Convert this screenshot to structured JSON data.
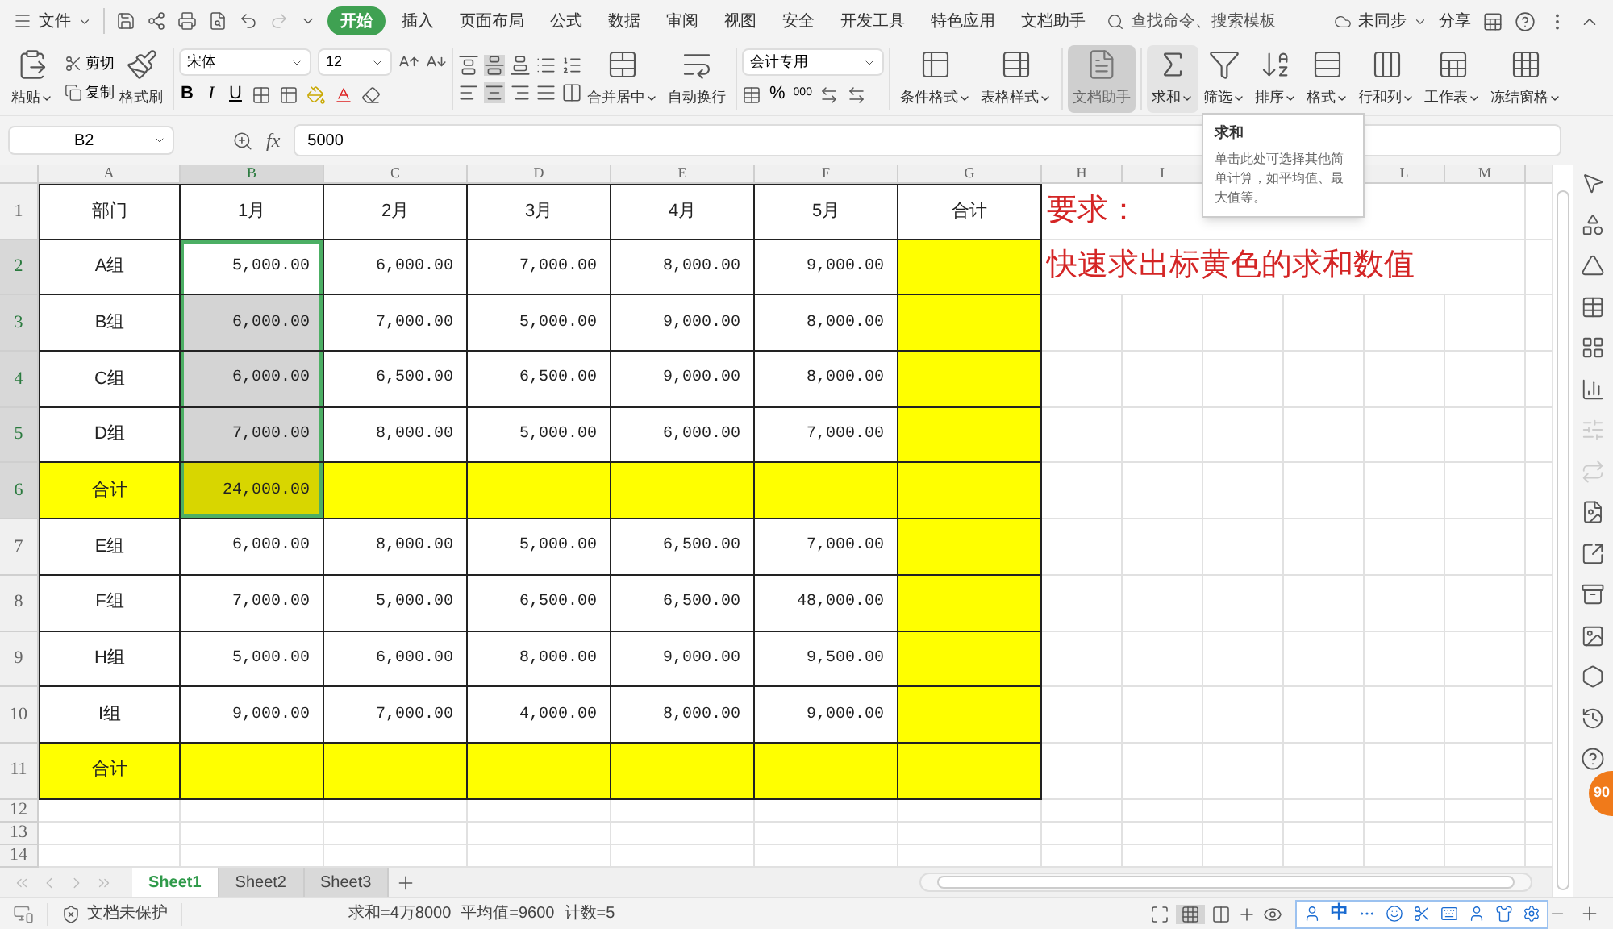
{
  "top_bar": {
    "file_menu": "文件",
    "tabs": [
      {
        "label": "开始",
        "selected": true
      },
      {
        "label": "插入",
        "selected": false
      },
      {
        "label": "页面布局",
        "selected": false
      },
      {
        "label": "公式",
        "selected": false
      },
      {
        "label": "数据",
        "selected": false
      },
      {
        "label": "审阅",
        "selected": false
      },
      {
        "label": "视图",
        "selected": false
      },
      {
        "label": "安全",
        "selected": false
      },
      {
        "label": "开发工具",
        "selected": false
      },
      {
        "label": "特色应用",
        "selected": false
      },
      {
        "label": "文档助手",
        "selected": false
      }
    ],
    "search": "查找命令、搜索模板",
    "sync": "未同步",
    "share": "分享"
  },
  "ribbon": {
    "paste": "粘贴",
    "cut": "剪切",
    "copy": "复制",
    "format_painter": "格式刷",
    "font_name": "宋体",
    "font_size": "12",
    "style_buttons": [
      "B",
      "I",
      "U"
    ],
    "merge": "合并居中",
    "wrap": "自动换行",
    "number_format": "会计专用",
    "percent": "%",
    "thousands": "000",
    "conditional_format": "条件格式",
    "table_style": "表格样式",
    "doc_assistant": {
      "label": "文档助手",
      "active": true
    },
    "tools": [
      {
        "label": "求和",
        "hovered": true
      },
      {
        "label": "筛选",
        "hovered": false
      },
      {
        "label": "排序",
        "hovered": false
      },
      {
        "label": "格式",
        "hovered": false
      },
      {
        "label": "行和列",
        "hovered": false
      },
      {
        "label": "工作表",
        "hovered": false
      },
      {
        "label": "冻结窗格",
        "hovered": false
      }
    ]
  },
  "formula_bar": {
    "cell_ref": "B2",
    "fx": "fx",
    "value": "5000"
  },
  "tooltip": {
    "title": "求和",
    "body": "单击此处可选择其他简单计算，如平均值、最大值等。"
  },
  "columns": [
    {
      "label": "A",
      "selected": false
    },
    {
      "label": "B",
      "selected": true
    },
    {
      "label": "C",
      "selected": false
    },
    {
      "label": "D",
      "selected": false
    },
    {
      "label": "E",
      "selected": false
    },
    {
      "label": "F",
      "selected": false
    },
    {
      "label": "G",
      "selected": false
    },
    {
      "label": "H",
      "selected": false
    },
    {
      "label": "I",
      "selected": false
    },
    {},
    {},
    {
      "label": "L",
      "selected": false
    },
    {
      "label": "M",
      "selected": false
    }
  ],
  "rows": [
    {
      "header": "1",
      "selected": false,
      "kind": "header",
      "note": "要求：",
      "cells": [
        {
          "text": "部门",
          "highlighted": false,
          "selected": false
        },
        {
          "text": "1月",
          "highlighted": false,
          "selected": false
        },
        {
          "text": "2月",
          "highlighted": false,
          "selected": false
        },
        {
          "text": "3月",
          "highlighted": false,
          "selected": false
        },
        {
          "text": "4月",
          "highlighted": false,
          "selected": false
        },
        {
          "text": "5月",
          "highlighted": false,
          "selected": false
        },
        {
          "text": "合计",
          "highlighted": false,
          "selected": false
        }
      ]
    },
    {
      "header": "2",
      "selected": true,
      "kind": "data",
      "note": "快速求出标黄色的求和数值",
      "cells": [
        {
          "text": "A组",
          "highlighted": false,
          "selected": false
        },
        {
          "text": "5,000.00",
          "highlighted": false,
          "selected": true,
          "active": true
        },
        {
          "text": "6,000.00",
          "highlighted": false,
          "selected": false
        },
        {
          "text": "7,000.00",
          "highlighted": false,
          "selected": false
        },
        {
          "text": "8,000.00",
          "highlighted": false,
          "selected": false
        },
        {
          "text": "9,000.00",
          "highlighted": false,
          "selected": false
        },
        {
          "highlighted": true,
          "selected": false
        }
      ]
    },
    {
      "header": "3",
      "selected": true,
      "kind": "data",
      "cells": [
        {
          "text": "B组",
          "highlighted": false,
          "selected": false
        },
        {
          "text": "6,000.00",
          "highlighted": false,
          "selected": true,
          "active": false
        },
        {
          "text": "7,000.00",
          "highlighted": false,
          "selected": false
        },
        {
          "text": "5,000.00",
          "highlighted": false,
          "selected": false
        },
        {
          "text": "9,000.00",
          "highlighted": false,
          "selected": false
        },
        {
          "text": "8,000.00",
          "highlighted": false,
          "selected": false
        },
        {
          "highlighted": true,
          "selected": false
        }
      ]
    },
    {
      "header": "4",
      "selected": true,
      "kind": "data",
      "cells": [
        {
          "text": "C组",
          "highlighted": false,
          "selected": false
        },
        {
          "text": "6,000.00",
          "highlighted": false,
          "selected": true,
          "active": false
        },
        {
          "text": "6,500.00",
          "highlighted": false,
          "selected": false
        },
        {
          "text": "6,500.00",
          "highlighted": false,
          "selected": false
        },
        {
          "text": "9,000.00",
          "highlighted": false,
          "selected": false
        },
        {
          "text": "8,000.00",
          "highlighted": false,
          "selected": false
        },
        {
          "highlighted": true,
          "selected": false
        }
      ]
    },
    {
      "header": "5",
      "selected": true,
      "kind": "data",
      "cells": [
        {
          "text": "D组",
          "highlighted": false,
          "selected": false
        },
        {
          "text": "7,000.00",
          "highlighted": false,
          "selected": true,
          "active": false
        },
        {
          "text": "8,000.00",
          "highlighted": false,
          "selected": false
        },
        {
          "text": "5,000.00",
          "highlighted": false,
          "selected": false
        },
        {
          "text": "6,000.00",
          "highlighted": false,
          "selected": false
        },
        {
          "text": "7,000.00",
          "highlighted": false,
          "selected": false
        },
        {
          "highlighted": true,
          "selected": false
        }
      ]
    },
    {
      "header": "6",
      "selected": true,
      "kind": "total",
      "cells": [
        {
          "text": "合计",
          "highlighted": true,
          "selected": false
        },
        {
          "text": "24,000.00",
          "highlighted": true,
          "selected": true,
          "active": false
        },
        {
          "highlighted": true,
          "selected": false
        },
        {
          "highlighted": true,
          "selected": false
        },
        {
          "highlighted": true,
          "selected": false
        },
        {
          "highlighted": true,
          "selected": false
        },
        {
          "highlighted": true,
          "selected": false
        }
      ]
    },
    {
      "header": "7",
      "selected": false,
      "kind": "data",
      "cells": [
        {
          "text": "E组",
          "highlighted": false,
          "selected": false
        },
        {
          "text": "6,000.00",
          "highlighted": false,
          "selected": false
        },
        {
          "text": "8,000.00",
          "highlighted": false,
          "selected": false
        },
        {
          "text": "5,000.00",
          "highlighted": false,
          "selected": false
        },
        {
          "text": "6,500.00",
          "highlighted": false,
          "selected": false
        },
        {
          "text": "7,000.00",
          "highlighted": false,
          "selected": false
        },
        {
          "highlighted": true,
          "selected": false
        }
      ]
    },
    {
      "header": "8",
      "selected": false,
      "kind": "data",
      "cells": [
        {
          "text": "F组",
          "highlighted": false,
          "selected": false
        },
        {
          "text": "7,000.00",
          "highlighted": false,
          "selected": false
        },
        {
          "text": "5,000.00",
          "highlighted": false,
          "selected": false
        },
        {
          "text": "6,500.00",
          "highlighted": false,
          "selected": false
        },
        {
          "text": "6,500.00",
          "highlighted": false,
          "selected": false
        },
        {
          "text": "48,000.00",
          "highlighted": false,
          "selected": false
        },
        {
          "highlighted": true,
          "selected": false
        }
      ]
    },
    {
      "header": "9",
      "selected": false,
      "kind": "data",
      "cells": [
        {
          "text": "H组",
          "highlighted": false,
          "selected": false
        },
        {
          "text": "5,000.00",
          "highlighted": false,
          "selected": false
        },
        {
          "text": "6,000.00",
          "highlighted": false,
          "selected": false
        },
        {
          "text": "8,000.00",
          "highlighted": false,
          "selected": false
        },
        {
          "text": "9,000.00",
          "highlighted": false,
          "selected": false
        },
        {
          "text": "9,500.00",
          "highlighted": false,
          "selected": false
        },
        {
          "highlighted": true,
          "selected": false
        }
      ]
    },
    {
      "header": "10",
      "selected": false,
      "kind": "data",
      "cells": [
        {
          "text": "I组",
          "highlighted": false,
          "selected": false
        },
        {
          "text": "9,000.00",
          "highlighted": false,
          "selected": false
        },
        {
          "text": "7,000.00",
          "highlighted": false,
          "selected": false
        },
        {
          "text": "4,000.00",
          "highlighted": false,
          "selected": false
        },
        {
          "text": "8,000.00",
          "highlighted": false,
          "selected": false
        },
        {
          "text": "9,000.00",
          "highlighted": false,
          "selected": false
        },
        {
          "highlighted": true,
          "selected": false
        }
      ]
    },
    {
      "header": "11",
      "selected": false,
      "kind": "total",
      "cells": [
        {
          "text": "合计",
          "highlighted": true,
          "selected": false
        },
        {
          "highlighted": true,
          "selected": false
        },
        {
          "highlighted": true,
          "selected": false
        },
        {
          "highlighted": true,
          "selected": false
        },
        {
          "highlighted": true,
          "selected": false
        },
        {
          "highlighted": true,
          "selected": false
        },
        {
          "highlighted": true,
          "selected": false
        }
      ]
    },
    {
      "header": "12",
      "selected": false,
      "kind": "blank"
    },
    {
      "header": "13",
      "selected": false,
      "kind": "blank"
    },
    {
      "header": "14",
      "selected": false,
      "kind": "blank"
    }
  ],
  "sheet_tabs": [
    {
      "label": "Sheet1",
      "selected": true
    },
    {
      "label": "Sheet2",
      "selected": false
    },
    {
      "label": "Sheet3",
      "selected": false
    }
  ],
  "status_bar": {
    "protection": "文档未保护",
    "sum": "求和=4万8000",
    "average": "平均值=9600",
    "count": "计数=5",
    "ime_mode": "中"
  },
  "badge": "90"
}
